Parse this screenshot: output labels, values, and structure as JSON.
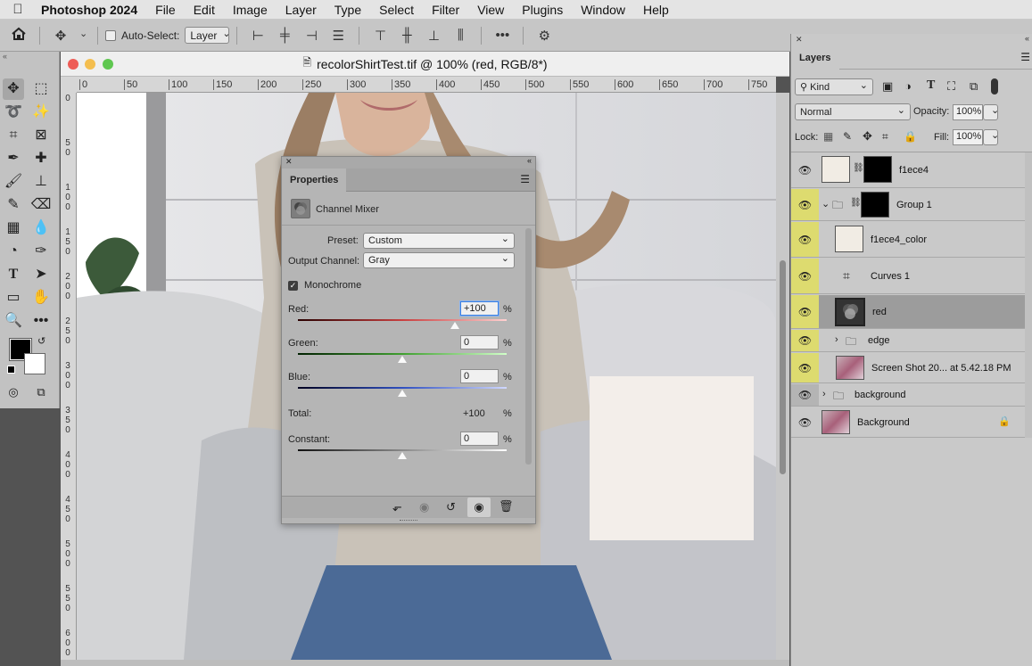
{
  "menubar": {
    "app_name": "Photoshop 2024",
    "items": [
      "File",
      "Edit",
      "Image",
      "Layer",
      "Type",
      "Select",
      "Filter",
      "View",
      "Plugins",
      "Window",
      "Help"
    ]
  },
  "options_bar": {
    "auto_select_label": "Auto-Select:",
    "auto_select_value": "Layer"
  },
  "document": {
    "title": "recolorShirtTest.tif @ 100% (red, RGB/8*)",
    "ruler_h": [
      "0",
      "50",
      "100",
      "150",
      "200",
      "250",
      "300",
      "350",
      "400",
      "450",
      "500",
      "550",
      "600",
      "650",
      "700",
      "750"
    ],
    "ruler_v": [
      "0",
      "5 0",
      "1 0 0",
      "1 5 0",
      "2 0 0",
      "2 5 0",
      "3 0 0",
      "3 5 0",
      "4 0 0",
      "4 5 0",
      "5 0 0",
      "5 5 0",
      "6 0 0"
    ],
    "swatch_color": "#f3eeea"
  },
  "properties": {
    "tab": "Properties",
    "adjustment_name": "Channel Mixer",
    "preset_label": "Preset:",
    "preset_value": "Custom",
    "output_label": "Output Channel:",
    "output_value": "Gray",
    "monochrome_label": "Monochrome",
    "monochrome_checked": true,
    "red_label": "Red:",
    "red_value": "+100",
    "green_label": "Green:",
    "green_value": "0",
    "blue_label": "Blue:",
    "blue_value": "0",
    "total_label": "Total:",
    "total_value": "+100",
    "constant_label": "Constant:",
    "constant_value": "0",
    "pct": "%",
    "red_level": 0.75,
    "green_level": 0.5,
    "blue_level": 0.5,
    "constant_level": 0.5
  },
  "layers_panel": {
    "title": "Layers",
    "filter_label": "Kind",
    "blend_mode": "Normal",
    "opacity_label": "Opacity:",
    "opacity_value": "100%",
    "lock_label": "Lock:",
    "fill_label": "Fill:",
    "fill_value": "100%",
    "layers": [
      {
        "name": "f1ece4"
      },
      {
        "name": "Group 1"
      },
      {
        "name": "f1ece4_color"
      },
      {
        "name": "Curves 1"
      },
      {
        "name": "red"
      },
      {
        "name": "edge"
      },
      {
        "name": "Screen Shot 20... at 5.42.18 PM"
      },
      {
        "name": "background"
      },
      {
        "name": "Background"
      }
    ]
  }
}
